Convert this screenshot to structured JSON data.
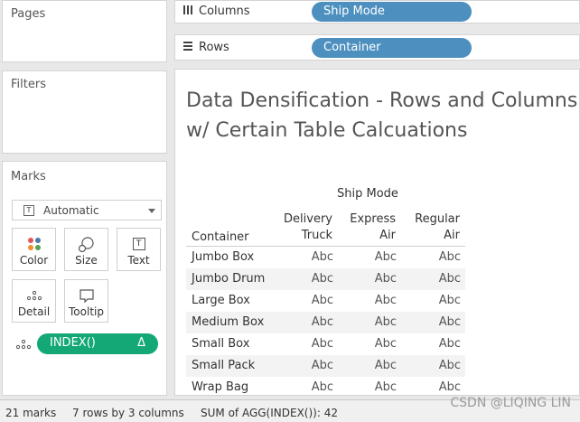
{
  "panels": {
    "pages_title": "Pages",
    "filters_title": "Filters",
    "marks_title": "Marks"
  },
  "marks": {
    "type": "Automatic",
    "buttons": {
      "color": "Color",
      "size": "Size",
      "text": "Text",
      "detail": "Detail",
      "tooltip": "Tooltip"
    },
    "text_icon_glyph": "T",
    "pill": {
      "label": "INDEX()",
      "delta": "Δ"
    }
  },
  "shelves": {
    "columns_label": "Columns",
    "rows_label": "Rows",
    "columns_pill": "Ship Mode",
    "rows_pill": "Container"
  },
  "view": {
    "title_line1": "Data Densification - Rows and Columns",
    "title_line2": "w/ Certain Table Calcuations",
    "column_group": "Ship Mode",
    "row_header": "Container",
    "columns": [
      {
        "line1": "Delivery",
        "line2": "Truck"
      },
      {
        "line1": "Express",
        "line2": "Air"
      },
      {
        "line1": "Regular",
        "line2": "Air"
      }
    ],
    "rows": [
      {
        "name": "Jumbo Box",
        "cells": [
          "Abc",
          "Abc",
          "Abc"
        ]
      },
      {
        "name": "Jumbo Drum",
        "cells": [
          "Abc",
          "Abc",
          "Abc"
        ]
      },
      {
        "name": "Large Box",
        "cells": [
          "Abc",
          "Abc",
          "Abc"
        ]
      },
      {
        "name": "Medium Box",
        "cells": [
          "Abc",
          "Abc",
          "Abc"
        ]
      },
      {
        "name": "Small Box",
        "cells": [
          "Abc",
          "Abc",
          "Abc"
        ]
      },
      {
        "name": "Small Pack",
        "cells": [
          "Abc",
          "Abc",
          "Abc"
        ]
      },
      {
        "name": "Wrap Bag",
        "cells": [
          "Abc",
          "Abc",
          "Abc"
        ]
      }
    ]
  },
  "status": {
    "marks": "21 marks",
    "dims": "7 rows by 3 columns",
    "sum": "SUM of AGG(INDEX()): 42"
  },
  "watermark": "CSDN @LIQING LIN",
  "colors": {
    "shelf_pill": "#4d90bf",
    "index_pill": "#14a876"
  }
}
